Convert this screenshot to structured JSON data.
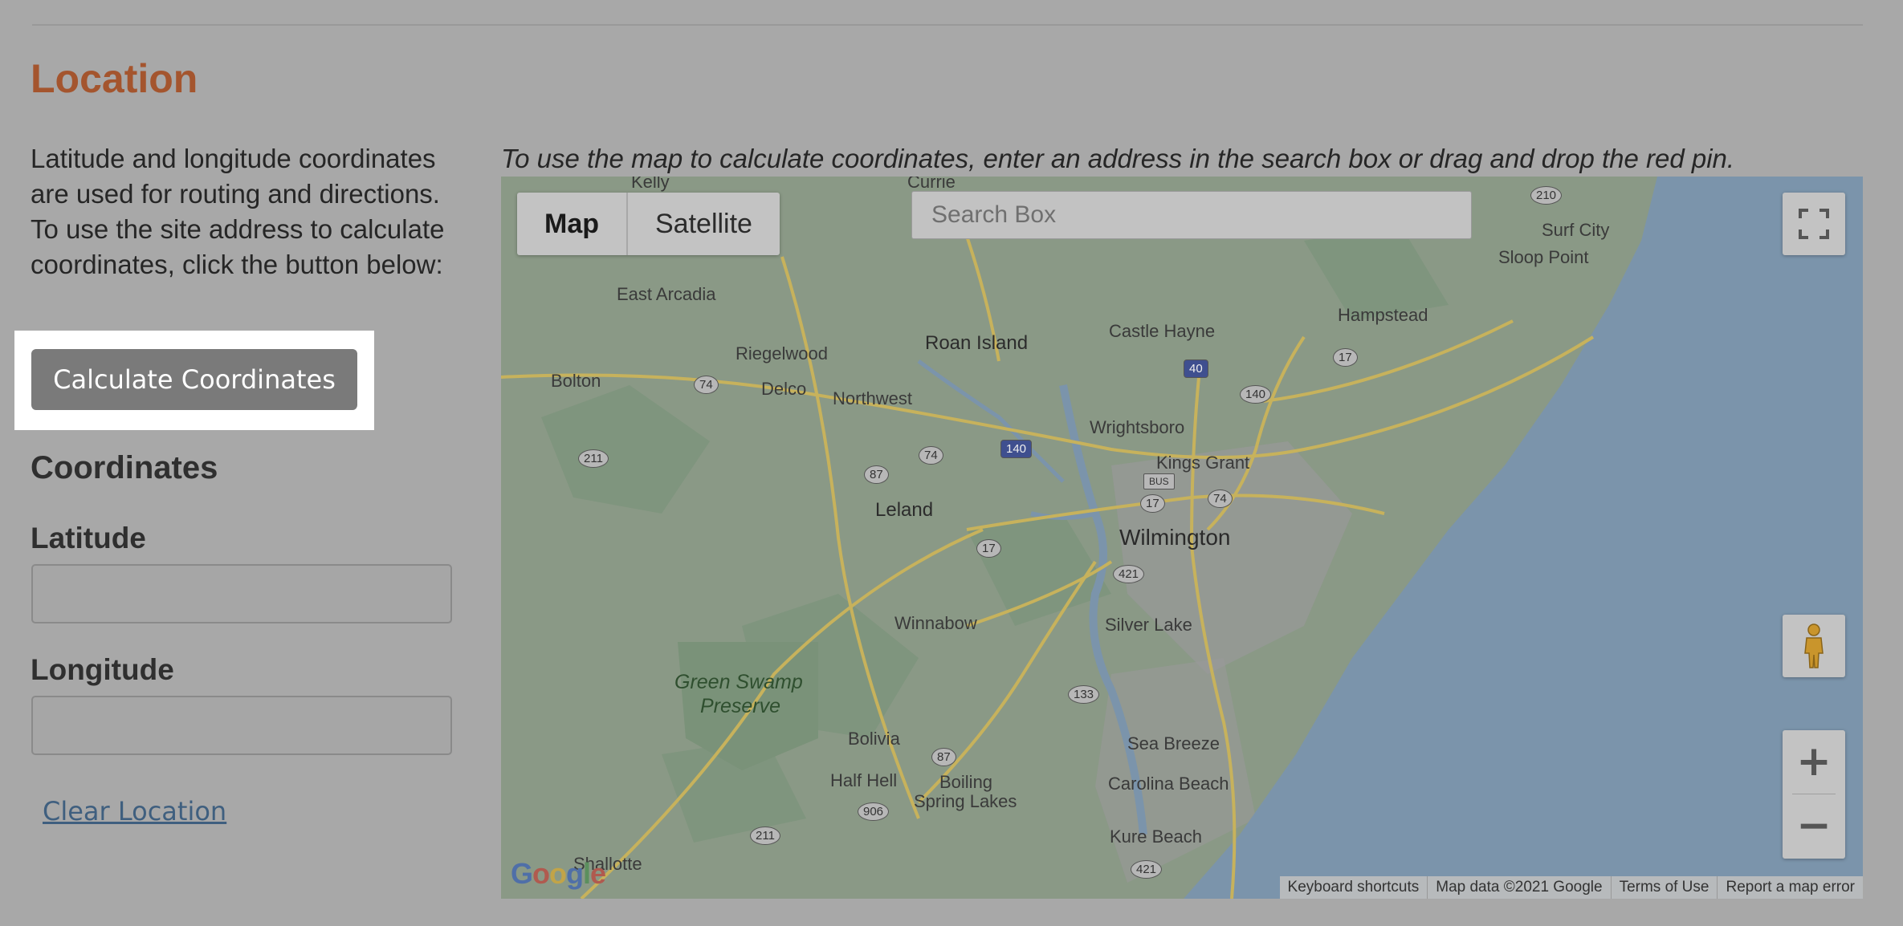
{
  "section": {
    "title": "Location",
    "description": "Latitude and longitude coordinates are used for routing and directions. To use the site address to calculate coordinates, click the button below:",
    "calculate_button": "Calculate Coordinates",
    "coordinates_title": "Coordinates",
    "latitude_label": "Latitude",
    "latitude_value": "",
    "longitude_label": "Longitude",
    "longitude_value": "",
    "clear_link": "Clear Location"
  },
  "map": {
    "instructions": "To use the map to calculate coordinates, enter an address in the search box or drag and drop the red pin.",
    "type_map": "Map",
    "type_satellite": "Satellite",
    "search_placeholder": "Search Box",
    "zoom_in": "+",
    "zoom_out": "−",
    "logo_text": "Google",
    "attribution": {
      "shortcuts": "Keyboard shortcuts",
      "map_data": "Map data ©2021 Google",
      "terms": "Terms of Use",
      "report": "Report a map error"
    },
    "places": {
      "kelly": "Kelly",
      "currie": "Currie",
      "surf_city": "Surf City",
      "sloop_point": "Sloop Point",
      "east_arcadia": "East Arcadia",
      "hampstead": "Hampstead",
      "roan_island": "Roan Island",
      "castle_hayne": "Castle Hayne",
      "riegelwood": "Riegelwood",
      "bolton": "Bolton",
      "delco": "Delco",
      "northwest": "Northwest",
      "wrightsboro": "Wrightsboro",
      "kings_grant": "Kings Grant",
      "leland": "Leland",
      "wilmington": "Wilmington",
      "winnabow": "Winnabow",
      "silver_lake": "Silver Lake",
      "green_swamp": "Green Swamp",
      "preserve": "Preserve",
      "bolivia": "Bolivia",
      "sea_breeze": "Sea Breeze",
      "half_hell": "Half Hell",
      "boiling": "Boiling",
      "spring_lakes": "Spring Lakes",
      "carolina_beach": "Carolina Beach",
      "kure_beach": "Kure Beach",
      "shallotte": "Shallotte"
    },
    "shields": {
      "r210a": "210",
      "r210b": "210",
      "r74a": "74",
      "i40": "40",
      "r140": "140",
      "r17a": "17",
      "r211a": "211",
      "r87a": "87",
      "r74b": "74",
      "i140": "140",
      "bus": "BUS",
      "r17b": "17",
      "r74c": "74",
      "r17c": "17",
      "r421a": "421",
      "r133": "133",
      "r87b": "87",
      "r906": "906",
      "r211b": "211",
      "r421b": "421"
    }
  },
  "colors": {
    "title": "#a4552e",
    "button": "#7a7a7a",
    "link": "#3f5f7f",
    "water": "#7b94ab",
    "land": "#8c9a88"
  }
}
